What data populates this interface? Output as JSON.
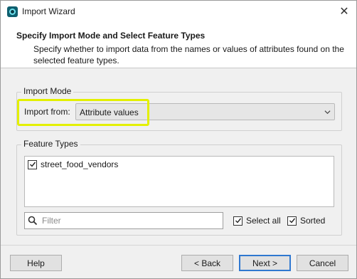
{
  "window": {
    "title": "Import Wizard",
    "close_glyph": "✕"
  },
  "header": {
    "title": "Specify Import Mode and Select Feature Types",
    "description": "Specify whether to import data from the names or values of attributes found on the selected feature types."
  },
  "import_mode": {
    "group_label": "Import Mode",
    "label": "Import from:",
    "selected_value": "Attribute values"
  },
  "feature_types": {
    "group_label": "Feature Types",
    "items": [
      {
        "label": "street_food_vendors",
        "checked": true
      }
    ],
    "filter_placeholder": "Filter",
    "select_all_label": "Select all",
    "sorted_label": "Sorted"
  },
  "buttons": {
    "help": "Help",
    "back": "< Back",
    "next": "Next >",
    "cancel": "Cancel"
  },
  "colors": {
    "highlight": "#e3f000",
    "default_button_border": "#2f78d0"
  }
}
